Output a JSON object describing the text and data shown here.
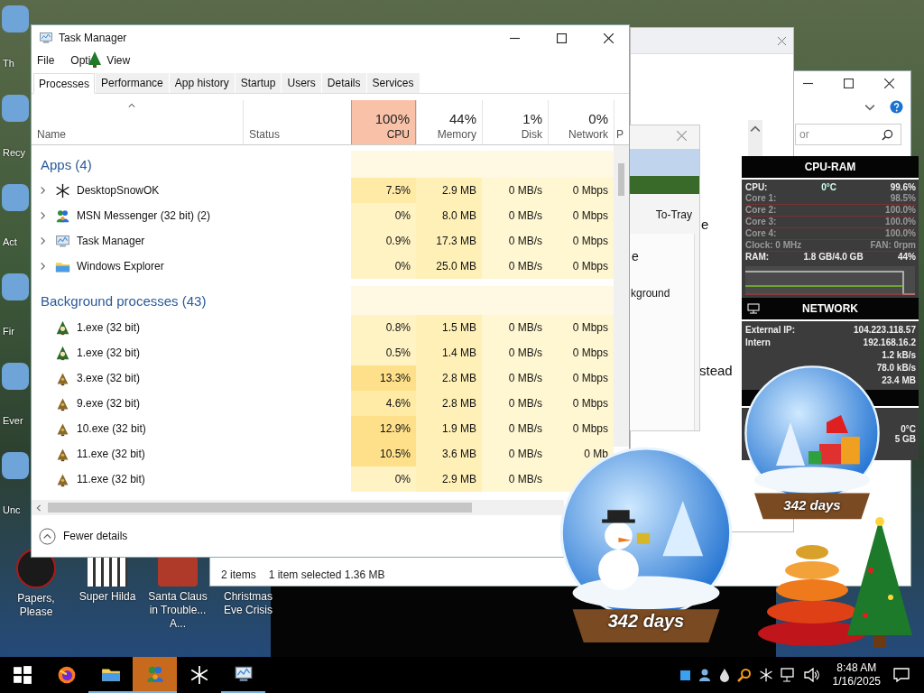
{
  "desktop": {
    "left_icons": [
      {
        "label": "Th"
      },
      {
        "label": "Recy"
      },
      {
        "label": "Act"
      },
      {
        "label": "Fir"
      },
      {
        "label": "Ever"
      },
      {
        "label": "Unc"
      }
    ],
    "bottom_icons": [
      {
        "label": "Papers, Please",
        "kind": "seal"
      },
      {
        "label": "Super Hilda",
        "kind": "pixel"
      },
      {
        "label": "Santa Claus in Trouble... A...",
        "kind": "santa"
      },
      {
        "label": "Christmas Eve Crisis",
        "kind": "blank"
      }
    ]
  },
  "explorer_window": {
    "search_placeholder": "or",
    "status_items": [
      "2 items",
      "1 item selected  1.36 MB"
    ]
  },
  "back_window": {
    "fragments": [
      "e",
      "stead"
    ]
  },
  "tray_window": {
    "button": "To-Tray",
    "fragments": [
      "e",
      "kground"
    ]
  },
  "task_manager": {
    "title": "Task Manager",
    "menu": [
      "File",
      "Opti",
      "View"
    ],
    "tabs": [
      {
        "label": "Processes",
        "selected": true
      },
      {
        "label": "Performance",
        "selected": false
      },
      {
        "label": "App history",
        "selected": false
      },
      {
        "label": "Startup",
        "selected": false
      },
      {
        "label": "Users",
        "selected": false
      },
      {
        "label": "Details",
        "selected": false
      },
      {
        "label": "Services",
        "selected": false
      }
    ],
    "columns": [
      {
        "label": "Name"
      },
      {
        "label": "Status"
      },
      {
        "label": "CPU",
        "percent": "100%"
      },
      {
        "label": "Memory",
        "percent": "44%"
      },
      {
        "label": "Disk",
        "percent": "1%"
      },
      {
        "label": "Network",
        "percent": "0%"
      },
      {
        "label": "P"
      }
    ],
    "groups": [
      {
        "title": "Apps (4)",
        "rows": [
          {
            "name": "DesktopSnowOK",
            "kind": "snowflake",
            "expandable": true,
            "cpu": "7.5%",
            "memory": "2.9 MB",
            "disk": "0 MB/s",
            "network": "0 Mbps"
          },
          {
            "name": "MSN Messenger (32 bit) (2)",
            "kind": "messenger",
            "expandable": true,
            "cpu": "0%",
            "memory": "8.0 MB",
            "disk": "0 MB/s",
            "network": "0 Mbps"
          },
          {
            "name": "Task Manager",
            "kind": "taskmgr",
            "expandable": true,
            "cpu": "0.9%",
            "memory": "17.3 MB",
            "disk": "0 MB/s",
            "network": "0 Mbps"
          },
          {
            "name": "Windows Explorer",
            "kind": "folder",
            "expandable": true,
            "cpu": "0%",
            "memory": "25.0 MB",
            "disk": "0 MB/s",
            "network": "0 Mbps"
          }
        ]
      },
      {
        "title": "Background processes (43)",
        "rows": [
          {
            "name": "1.exe (32 bit)",
            "kind": "tree-face",
            "expandable": false,
            "cpu": "0.8%",
            "memory": "1.5 MB",
            "disk": "0 MB/s",
            "network": "0 Mbps"
          },
          {
            "name": "1.exe (32 bit)",
            "kind": "tree-face",
            "expandable": false,
            "cpu": "0.5%",
            "memory": "1.4 MB",
            "disk": "0 MB/s",
            "network": "0 Mbps"
          },
          {
            "name": "3.exe (32 bit)",
            "kind": "tree",
            "expandable": false,
            "cpu": "13.3%",
            "memory": "2.8 MB",
            "disk": "0 MB/s",
            "network": "0 Mbps"
          },
          {
            "name": "9.exe (32 bit)",
            "kind": "tree",
            "expandable": false,
            "cpu": "4.6%",
            "memory": "2.8 MB",
            "disk": "0 MB/s",
            "network": "0 Mbps"
          },
          {
            "name": "10.exe (32 bit)",
            "kind": "tree",
            "expandable": false,
            "cpu": "12.9%",
            "memory": "1.9 MB",
            "disk": "0 MB/s",
            "network": "0 Mbps"
          },
          {
            "name": "11.exe (32 bit)",
            "kind": "tree",
            "expandable": false,
            "cpu": "10.5%",
            "memory": "3.6 MB",
            "disk": "0 MB/s",
            "network": "0 Mb"
          },
          {
            "name": "11.exe (32 bit)",
            "kind": "tree",
            "expandable": false,
            "cpu": "0%",
            "memory": "2.9 MB",
            "disk": "0 MB/s"
          }
        ]
      }
    ],
    "footer": "Fewer details"
  },
  "cpu_ram_widget": {
    "title": "CPU-RAM",
    "cpu_label": "CPU:",
    "temperature": "0°C",
    "cpu_total": "99.6%",
    "cores": [
      {
        "label": "Core 1:",
        "value": "98.5%"
      },
      {
        "label": "Core 2:",
        "value": "100.0%"
      },
      {
        "label": "Core 3:",
        "value": "100.0%"
      },
      {
        "label": "Core 4:",
        "value": "100.0%"
      }
    ],
    "clock": "Clock: 0 MHz",
    "fan": "FAN: 0rpm",
    "ram_label": "RAM:",
    "ram_used": "1.8 GB/4.0 GB",
    "ram_percent": "44%"
  },
  "network_widget": {
    "title": "NETWORK",
    "rows": [
      {
        "label": "External IP:",
        "value": "104.223.118.57"
      },
      {
        "label": "Intern",
        "value": "192.168.16.2"
      },
      {
        "value": "1.2 kB/s"
      },
      {
        "value": "78.0 kB/s"
      },
      {
        "value": "23.4 MB"
      }
    ]
  },
  "third_widget": {
    "fragments": [
      "0°C",
      "5 GB"
    ]
  },
  "snow_globes": [
    {
      "caption": "342 days",
      "kind": "snowman"
    },
    {
      "caption": "342 days",
      "kind": "gifts"
    }
  ],
  "taskbar": {
    "apps": [
      {
        "kind": "start",
        "selected": false,
        "running": false
      },
      {
        "kind": "firefox",
        "selected": false,
        "running": false
      },
      {
        "kind": "folder",
        "selected": false,
        "running": true
      },
      {
        "kind": "messenger",
        "selected": true,
        "running": true
      },
      {
        "kind": "snowflake",
        "selected": false,
        "running": false
      },
      {
        "kind": "taskmgr",
        "selected": false,
        "running": true
      }
    ],
    "tray": [
      {
        "kind": "square"
      },
      {
        "kind": "user"
      },
      {
        "kind": "drop"
      },
      {
        "kind": "search"
      },
      {
        "kind": "snowflake"
      },
      {
        "kind": "network"
      },
      {
        "kind": "volume"
      }
    ],
    "time": "8:48 AM",
    "date": "1/16/2025"
  }
}
